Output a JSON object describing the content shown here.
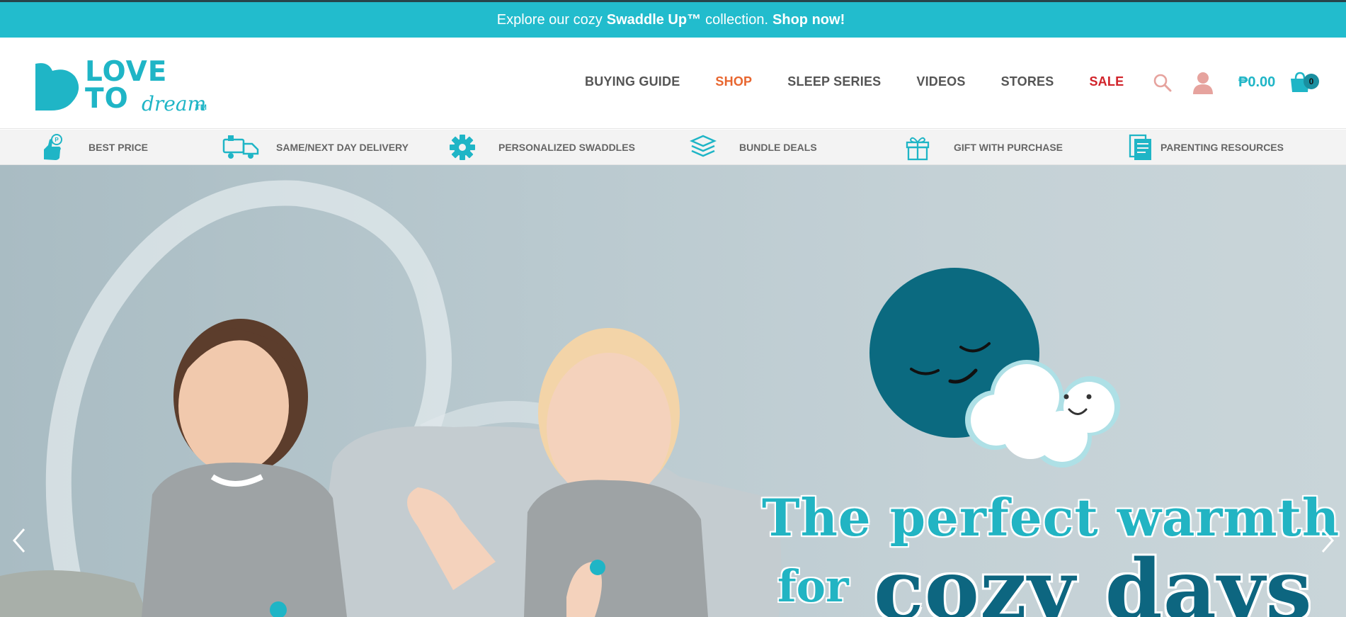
{
  "announcement": {
    "prefix": "Explore our cozy",
    "product": "Swaddle Up™",
    "middle": "collection.",
    "cta": "Shop now!"
  },
  "logo": {
    "line1": "LOVE",
    "line2": "TO",
    "line3": "dream",
    "tm": "TM"
  },
  "nav": {
    "items": [
      {
        "label": "BUYING GUIDE"
      },
      {
        "label": "SHOP"
      },
      {
        "label": "SLEEP SERIES"
      },
      {
        "label": "VIDEOS"
      },
      {
        "label": "STORES"
      },
      {
        "label": "SALE"
      }
    ]
  },
  "header_icons": {
    "search": "search-icon",
    "account": "user-icon",
    "cart_total": "₱0.00",
    "cart": "shopping-bag-icon",
    "cart_count": "0"
  },
  "features": [
    {
      "icon": "price-tag-hand-icon",
      "label": "BEST PRICE"
    },
    {
      "icon": "delivery-truck-icon",
      "label": "SAME/NEXT DAY DELIVERY"
    },
    {
      "icon": "gear-icon",
      "label": "PERSONALIZED SWADDLES"
    },
    {
      "icon": "stack-icon",
      "label": "BUNDLE DEALS"
    },
    {
      "icon": "gift-icon",
      "label": "GIFT WITH PURCHASE"
    },
    {
      "icon": "book-icon",
      "label": "PARENTING RESOURCES"
    }
  ],
  "hero": {
    "headline_line1": "The perfect warmth",
    "headline_for": "for",
    "headline_emphasis": "cozy days"
  },
  "colors": {
    "brand_teal": "#22bccd",
    "dark_teal": "#0d6680",
    "shop_orange": "#e8662f",
    "sale_red": "#d1232a"
  }
}
